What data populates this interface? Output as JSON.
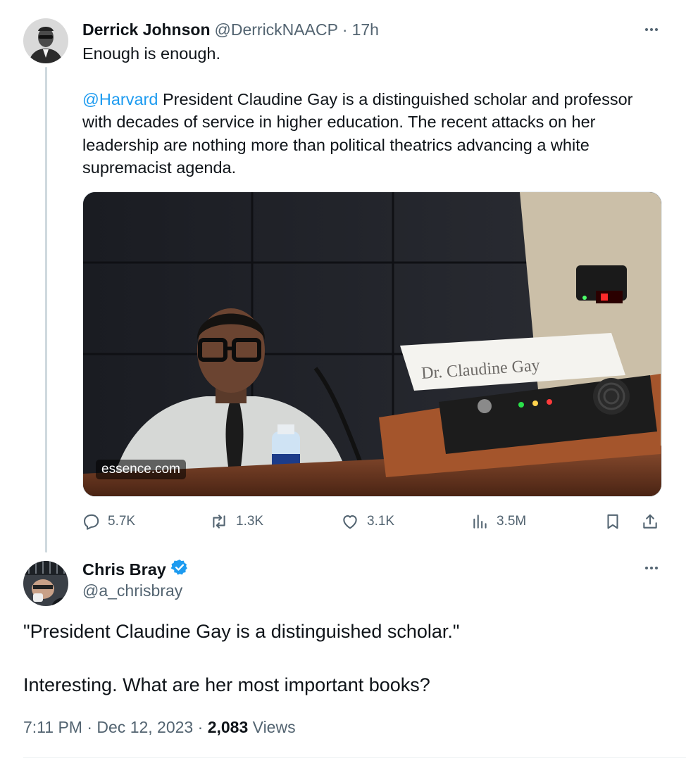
{
  "tweet1": {
    "author_name": "Derrick Johnson",
    "handle": "@DerrickNAACP",
    "separator": "·",
    "time": "17h",
    "line1": "Enough is enough.",
    "mention": "@Harvard",
    "body": " President Claudine Gay is a distinguished scholar and professor with decades of service in higher education. The recent attacks on her leadership are nothing more than political theatrics advancing a white supremacist agenda.",
    "media": {
      "nameplate_text": "Dr. Claudine Gay",
      "source_label": "essence.com"
    },
    "actions": {
      "replies": "5.7K",
      "retweets": "1.3K",
      "likes": "3.1K",
      "views": "3.5M"
    }
  },
  "tweet2": {
    "author_name": "Chris Bray",
    "handle": "@a_chrisbray",
    "verified": true,
    "line1": "\"President Claudine Gay is a distinguished scholar.\"",
    "line2": "Interesting. What are her most important books?",
    "time": "7:11 PM",
    "date": "Dec 12, 2023",
    "separator": "·",
    "views_count": "2,083",
    "views_label": "Views"
  },
  "icons": {
    "reply": "reply-icon",
    "retweet": "retweet-icon",
    "like": "heart-icon",
    "views": "analytics-icon",
    "bookmark": "bookmark-icon",
    "share": "share-icon",
    "more": "more-icon",
    "verified": "verified-badge-icon"
  },
  "colors": {
    "accent": "#1d9bf0",
    "text": "#0f1419",
    "muted": "#536471"
  }
}
